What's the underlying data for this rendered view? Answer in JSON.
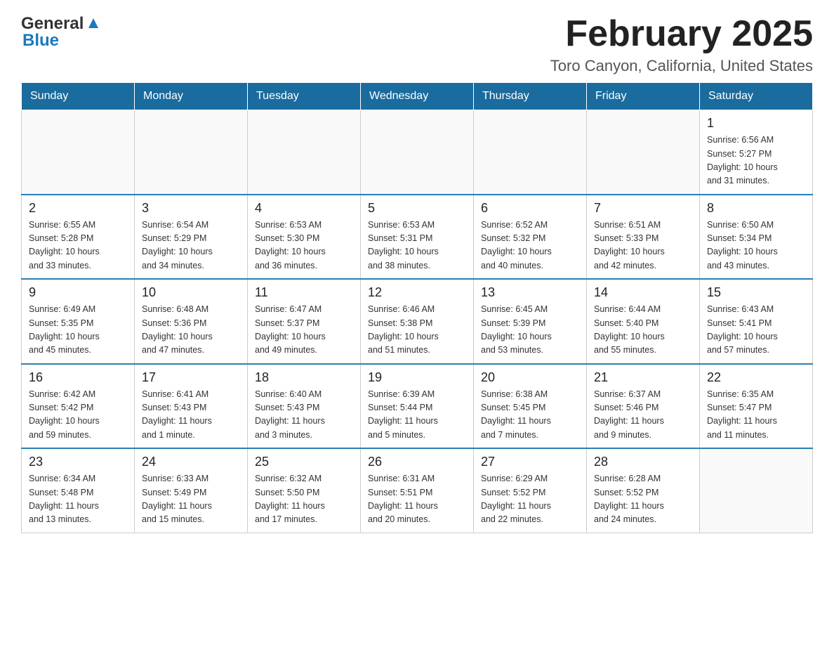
{
  "header": {
    "logo": {
      "general": "General",
      "blue": "Blue"
    },
    "title": "February 2025",
    "location": "Toro Canyon, California, United States"
  },
  "weekdays": [
    "Sunday",
    "Monday",
    "Tuesday",
    "Wednesday",
    "Thursday",
    "Friday",
    "Saturday"
  ],
  "weeks": [
    [
      {
        "day": "",
        "info": ""
      },
      {
        "day": "",
        "info": ""
      },
      {
        "day": "",
        "info": ""
      },
      {
        "day": "",
        "info": ""
      },
      {
        "day": "",
        "info": ""
      },
      {
        "day": "",
        "info": ""
      },
      {
        "day": "1",
        "info": "Sunrise: 6:56 AM\nSunset: 5:27 PM\nDaylight: 10 hours\nand 31 minutes."
      }
    ],
    [
      {
        "day": "2",
        "info": "Sunrise: 6:55 AM\nSunset: 5:28 PM\nDaylight: 10 hours\nand 33 minutes."
      },
      {
        "day": "3",
        "info": "Sunrise: 6:54 AM\nSunset: 5:29 PM\nDaylight: 10 hours\nand 34 minutes."
      },
      {
        "day": "4",
        "info": "Sunrise: 6:53 AM\nSunset: 5:30 PM\nDaylight: 10 hours\nand 36 minutes."
      },
      {
        "day": "5",
        "info": "Sunrise: 6:53 AM\nSunset: 5:31 PM\nDaylight: 10 hours\nand 38 minutes."
      },
      {
        "day": "6",
        "info": "Sunrise: 6:52 AM\nSunset: 5:32 PM\nDaylight: 10 hours\nand 40 minutes."
      },
      {
        "day": "7",
        "info": "Sunrise: 6:51 AM\nSunset: 5:33 PM\nDaylight: 10 hours\nand 42 minutes."
      },
      {
        "day": "8",
        "info": "Sunrise: 6:50 AM\nSunset: 5:34 PM\nDaylight: 10 hours\nand 43 minutes."
      }
    ],
    [
      {
        "day": "9",
        "info": "Sunrise: 6:49 AM\nSunset: 5:35 PM\nDaylight: 10 hours\nand 45 minutes."
      },
      {
        "day": "10",
        "info": "Sunrise: 6:48 AM\nSunset: 5:36 PM\nDaylight: 10 hours\nand 47 minutes."
      },
      {
        "day": "11",
        "info": "Sunrise: 6:47 AM\nSunset: 5:37 PM\nDaylight: 10 hours\nand 49 minutes."
      },
      {
        "day": "12",
        "info": "Sunrise: 6:46 AM\nSunset: 5:38 PM\nDaylight: 10 hours\nand 51 minutes."
      },
      {
        "day": "13",
        "info": "Sunrise: 6:45 AM\nSunset: 5:39 PM\nDaylight: 10 hours\nand 53 minutes."
      },
      {
        "day": "14",
        "info": "Sunrise: 6:44 AM\nSunset: 5:40 PM\nDaylight: 10 hours\nand 55 minutes."
      },
      {
        "day": "15",
        "info": "Sunrise: 6:43 AM\nSunset: 5:41 PM\nDaylight: 10 hours\nand 57 minutes."
      }
    ],
    [
      {
        "day": "16",
        "info": "Sunrise: 6:42 AM\nSunset: 5:42 PM\nDaylight: 10 hours\nand 59 minutes."
      },
      {
        "day": "17",
        "info": "Sunrise: 6:41 AM\nSunset: 5:43 PM\nDaylight: 11 hours\nand 1 minute."
      },
      {
        "day": "18",
        "info": "Sunrise: 6:40 AM\nSunset: 5:43 PM\nDaylight: 11 hours\nand 3 minutes."
      },
      {
        "day": "19",
        "info": "Sunrise: 6:39 AM\nSunset: 5:44 PM\nDaylight: 11 hours\nand 5 minutes."
      },
      {
        "day": "20",
        "info": "Sunrise: 6:38 AM\nSunset: 5:45 PM\nDaylight: 11 hours\nand 7 minutes."
      },
      {
        "day": "21",
        "info": "Sunrise: 6:37 AM\nSunset: 5:46 PM\nDaylight: 11 hours\nand 9 minutes."
      },
      {
        "day": "22",
        "info": "Sunrise: 6:35 AM\nSunset: 5:47 PM\nDaylight: 11 hours\nand 11 minutes."
      }
    ],
    [
      {
        "day": "23",
        "info": "Sunrise: 6:34 AM\nSunset: 5:48 PM\nDaylight: 11 hours\nand 13 minutes."
      },
      {
        "day": "24",
        "info": "Sunrise: 6:33 AM\nSunset: 5:49 PM\nDaylight: 11 hours\nand 15 minutes."
      },
      {
        "day": "25",
        "info": "Sunrise: 6:32 AM\nSunset: 5:50 PM\nDaylight: 11 hours\nand 17 minutes."
      },
      {
        "day": "26",
        "info": "Sunrise: 6:31 AM\nSunset: 5:51 PM\nDaylight: 11 hours\nand 20 minutes."
      },
      {
        "day": "27",
        "info": "Sunrise: 6:29 AM\nSunset: 5:52 PM\nDaylight: 11 hours\nand 22 minutes."
      },
      {
        "day": "28",
        "info": "Sunrise: 6:28 AM\nSunset: 5:52 PM\nDaylight: 11 hours\nand 24 minutes."
      },
      {
        "day": "",
        "info": ""
      }
    ]
  ],
  "colors": {
    "header_bg": "#1a6b9e",
    "header_text": "#ffffff",
    "border": "#2a7fb5"
  }
}
